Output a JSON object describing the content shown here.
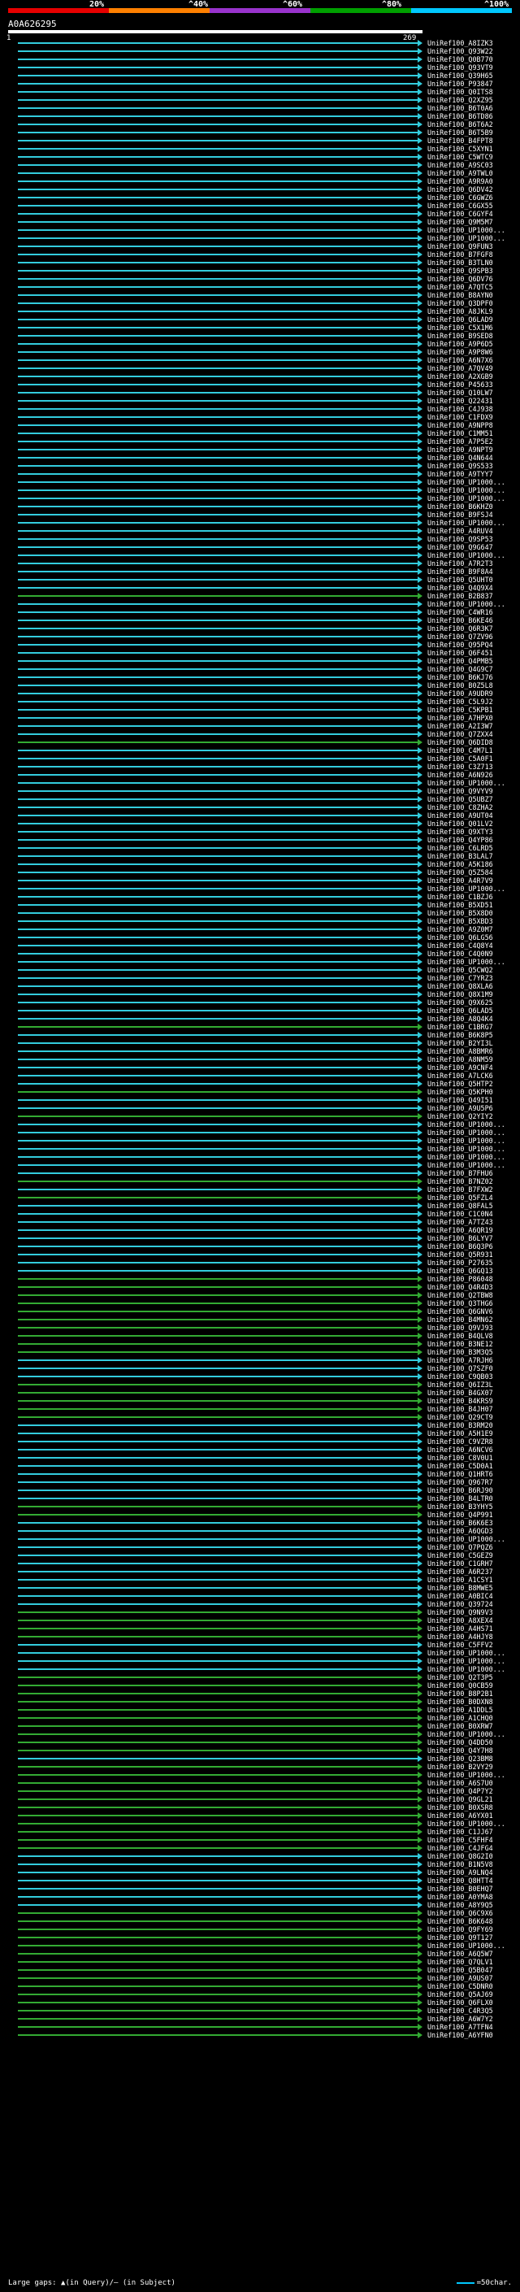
{
  "scale": {
    "labels": [
      "20%",
      "^40%",
      "^60%",
      "^80%",
      "^100%"
    ],
    "colors": [
      "#e60000",
      "#ff8000",
      "#9933cc",
      "#00a000",
      "#00c8ff"
    ]
  },
  "query": {
    "name": "A0A626295",
    "start": "1",
    "end": "269"
  },
  "legend": {
    "left": "Large gaps: ▲(in Query)/– (in Subject)",
    "right": "=50char."
  },
  "colors": {
    "hit_blue": "#33ccdd",
    "hit_green": "#33aa33",
    "background": "#000000"
  },
  "hits": [
    {
      "label": "UniRef100_A8IZK3",
      "color": "b"
    },
    {
      "label": "UniRef100_Q93W22",
      "color": "b"
    },
    {
      "label": "UniRef100_Q0B770",
      "color": "b"
    },
    {
      "label": "UniRef100_Q93VT9",
      "color": "b"
    },
    {
      "label": "UniRef100_Q39H65",
      "color": "b"
    },
    {
      "label": "UniRef100_P93847",
      "color": "b"
    },
    {
      "label": "UniRef100_Q0ITS8",
      "color": "b"
    },
    {
      "label": "UniRef100_Q2XZ95",
      "color": "b"
    },
    {
      "label": "UniRef100_B6T0A6",
      "color": "b"
    },
    {
      "label": "UniRef100_B6TD86",
      "color": "b"
    },
    {
      "label": "UniRef100_B6T6A2",
      "color": "b"
    },
    {
      "label": "UniRef100_B6T5B9",
      "color": "b"
    },
    {
      "label": "UniRef100_B4FPT8",
      "color": "b"
    },
    {
      "label": "UniRef100_C5XYN1",
      "color": "b"
    },
    {
      "label": "UniRef100_C5WTC9",
      "color": "b"
    },
    {
      "label": "UniRef100_A9SC03",
      "color": "b"
    },
    {
      "label": "UniRef100_A9TWL0",
      "color": "b"
    },
    {
      "label": "UniRef100_A9R9A0",
      "color": "b"
    },
    {
      "label": "UniRef100_Q6DV42",
      "color": "b"
    },
    {
      "label": "UniRef100_C6GWZ6",
      "color": "b"
    },
    {
      "label": "UniRef100_C6GX55",
      "color": "b"
    },
    {
      "label": "UniRef100_C6GYF4",
      "color": "b"
    },
    {
      "label": "UniRef100_Q9M5M7",
      "color": "b"
    },
    {
      "label": "UniRef100_UP1000...",
      "color": "b"
    },
    {
      "label": "UniRef100_UP1000...",
      "color": "b"
    },
    {
      "label": "UniRef100_Q9FUN3",
      "color": "b"
    },
    {
      "label": "UniRef100_B7FGF8",
      "color": "b"
    },
    {
      "label": "UniRef100_B3TLN0",
      "color": "b"
    },
    {
      "label": "UniRef100_Q9SPB3",
      "color": "b"
    },
    {
      "label": "UniRef100_Q6DV76",
      "color": "b"
    },
    {
      "label": "UniRef100_A7QTC5",
      "color": "b"
    },
    {
      "label": "UniRef100_B8AYN0",
      "color": "b"
    },
    {
      "label": "UniRef100_Q3DPF0",
      "color": "b"
    },
    {
      "label": "UniRef100_A8JKL9",
      "color": "b"
    },
    {
      "label": "UniRef100_Q6LAD9",
      "color": "b"
    },
    {
      "label": "UniRef100_C5X1M6",
      "color": "b"
    },
    {
      "label": "UniRef100_B9SED8",
      "color": "b"
    },
    {
      "label": "UniRef100_A9P6D5",
      "color": "b"
    },
    {
      "label": "UniRef100_A9P8W6",
      "color": "b"
    },
    {
      "label": "UniRef100_A6N7X6",
      "color": "b"
    },
    {
      "label": "UniRef100_A7QV49",
      "color": "b"
    },
    {
      "label": "UniRef100_A2XGB9",
      "color": "b"
    },
    {
      "label": "UniRef100_P45633",
      "color": "b"
    },
    {
      "label": "UniRef100_Q10LW7",
      "color": "b"
    },
    {
      "label": "UniRef100_Q22431",
      "color": "b"
    },
    {
      "label": "UniRef100_C4J938",
      "color": "b"
    },
    {
      "label": "UniRef100_C1FDX9",
      "color": "b"
    },
    {
      "label": "UniRef100_A9NPP8",
      "color": "b"
    },
    {
      "label": "UniRef100_C1MM51",
      "color": "b"
    },
    {
      "label": "UniRef100_A7P5E2",
      "color": "b"
    },
    {
      "label": "UniRef100_A9NPT9",
      "color": "b"
    },
    {
      "label": "UniRef100_Q4N644",
      "color": "b"
    },
    {
      "label": "UniRef100_Q9S533",
      "color": "b"
    },
    {
      "label": "UniRef100_A9TYY7",
      "color": "b"
    },
    {
      "label": "UniRef100_UP1000...",
      "color": "b"
    },
    {
      "label": "UniRef100_UP1000...",
      "color": "b"
    },
    {
      "label": "UniRef100_UP1000...",
      "color": "b"
    },
    {
      "label": "UniRef100_B6KHZ0",
      "color": "b"
    },
    {
      "label": "UniRef100_B9FSJ4",
      "color": "b"
    },
    {
      "label": "UniRef100_UP1000...",
      "color": "b"
    },
    {
      "label": "UniRef100_A4RUV4",
      "color": "b"
    },
    {
      "label": "UniRef100_Q9SP53",
      "color": "b"
    },
    {
      "label": "UniRef100_Q9G647",
      "color": "b"
    },
    {
      "label": "UniRef100_UP1000...",
      "color": "b"
    },
    {
      "label": "UniRef100_A7R2T3",
      "color": "b"
    },
    {
      "label": "UniRef100_B9F8A4",
      "color": "b"
    },
    {
      "label": "UniRef100_Q5UHT0",
      "color": "b"
    },
    {
      "label": "UniRef100_Q4Q9X4",
      "color": "b"
    },
    {
      "label": "UniRef100_B2B837",
      "color": "g"
    },
    {
      "label": "UniRef100_UP1000...",
      "color": "b"
    },
    {
      "label": "UniRef100_C4WR16",
      "color": "b"
    },
    {
      "label": "UniRef100_B6KE46",
      "color": "b"
    },
    {
      "label": "UniRef100_Q6R3K7",
      "color": "b"
    },
    {
      "label": "UniRef100_Q7ZV96",
      "color": "b"
    },
    {
      "label": "UniRef100_Q95PQ4",
      "color": "b"
    },
    {
      "label": "UniRef100_Q6F451",
      "color": "b"
    },
    {
      "label": "UniRef100_Q4PMB5",
      "color": "b"
    },
    {
      "label": "UniRef100_Q4G9C7",
      "color": "b"
    },
    {
      "label": "UniRef100_B6KJ76",
      "color": "b"
    },
    {
      "label": "UniRef100_B0Z5L8",
      "color": "b"
    },
    {
      "label": "UniRef100_A9UDR9",
      "color": "b"
    },
    {
      "label": "UniRef100_C5L9J2",
      "color": "b"
    },
    {
      "label": "UniRef100_C5KPB1",
      "color": "b"
    },
    {
      "label": "UniRef100_A7HPX0",
      "color": "b"
    },
    {
      "label": "UniRef100_A2I3W7",
      "color": "b"
    },
    {
      "label": "UniRef100_Q7ZXX4",
      "color": "b"
    },
    {
      "label": "UniRef100_Q6DID8",
      "color": "g"
    },
    {
      "label": "UniRef100_C4M7L1",
      "color": "b"
    },
    {
      "label": "UniRef100_C5A0F1",
      "color": "b"
    },
    {
      "label": "UniRef100_C3Z713",
      "color": "b"
    },
    {
      "label": "UniRef100_A6N926",
      "color": "b"
    },
    {
      "label": "UniRef100_UP1000...",
      "color": "b"
    },
    {
      "label": "UniRef100_Q9VYV9",
      "color": "b"
    },
    {
      "label": "UniRef100_Q5UBZ7",
      "color": "b"
    },
    {
      "label": "UniRef100_C8ZHA2",
      "color": "b"
    },
    {
      "label": "UniRef100_A9UT04",
      "color": "b"
    },
    {
      "label": "UniRef100_Q01LV2",
      "color": "b"
    },
    {
      "label": "UniRef100_Q9XTY3",
      "color": "b"
    },
    {
      "label": "UniRef100_Q4YP86",
      "color": "b"
    },
    {
      "label": "UniRef100_C6LRD5",
      "color": "b"
    },
    {
      "label": "UniRef100_B3LAL7",
      "color": "b"
    },
    {
      "label": "UniRef100_A5K186",
      "color": "b"
    },
    {
      "label": "UniRef100_Q5Z584",
      "color": "b"
    },
    {
      "label": "UniRef100_A4R7V9",
      "color": "b"
    },
    {
      "label": "UniRef100_UP1000...",
      "color": "b"
    },
    {
      "label": "UniRef100_C1BZJ6",
      "color": "b"
    },
    {
      "label": "UniRef100_B5XD51",
      "color": "b"
    },
    {
      "label": "UniRef100_B5X8D0",
      "color": "b"
    },
    {
      "label": "UniRef100_B5XBD3",
      "color": "b"
    },
    {
      "label": "UniRef100_A9Z0M7",
      "color": "b"
    },
    {
      "label": "UniRef100_Q6LG56",
      "color": "b"
    },
    {
      "label": "UniRef100_C4Q8Y4",
      "color": "b"
    },
    {
      "label": "UniRef100_C4Q0N9",
      "color": "b"
    },
    {
      "label": "UniRef100_UP1000...",
      "color": "b"
    },
    {
      "label": "UniRef100_Q5CWQ2",
      "color": "b"
    },
    {
      "label": "UniRef100_C7YRZ3",
      "color": "b"
    },
    {
      "label": "UniRef100_Q8XLA6",
      "color": "b"
    },
    {
      "label": "UniRef100_Q8X1M9",
      "color": "b"
    },
    {
      "label": "UniRef100_Q9X625",
      "color": "b"
    },
    {
      "label": "UniRef100_Q6LAD5",
      "color": "b"
    },
    {
      "label": "UniRef100_A8Q4K4",
      "color": "b"
    },
    {
      "label": "UniRef100_C1BRG7",
      "color": "g"
    },
    {
      "label": "UniRef100_B6K8P5",
      "color": "b"
    },
    {
      "label": "UniRef100_B2YI3L",
      "color": "b"
    },
    {
      "label": "UniRef100_A8BMR6",
      "color": "b"
    },
    {
      "label": "UniRef100_A8NM59",
      "color": "b"
    },
    {
      "label": "UniRef100_A9CNF4",
      "color": "b"
    },
    {
      "label": "UniRef100_A7LCK6",
      "color": "b"
    },
    {
      "label": "UniRef100_Q5HTP2",
      "color": "b"
    },
    {
      "label": "UniRef100_Q5KPH0",
      "color": "g"
    },
    {
      "label": "UniRef100_Q49I51",
      "color": "b"
    },
    {
      "label": "UniRef100_A9U5P6",
      "color": "b"
    },
    {
      "label": "UniRef100_Q2YIY2",
      "color": "g"
    },
    {
      "label": "UniRef100_UP1000...",
      "color": "b"
    },
    {
      "label": "UniRef100_UP1000...",
      "color": "b"
    },
    {
      "label": "UniRef100_UP1000...",
      "color": "b"
    },
    {
      "label": "UniRef100_UP1000...",
      "color": "b"
    },
    {
      "label": "UniRef100_UP1000...",
      "color": "b"
    },
    {
      "label": "UniRef100_UP1000...",
      "color": "b"
    },
    {
      "label": "UniRef100_B7FHU6",
      "color": "b"
    },
    {
      "label": "UniRef100_B7NZ02",
      "color": "g"
    },
    {
      "label": "UniRef100_B7FXW2",
      "color": "b"
    },
    {
      "label": "UniRef100_Q5FZL4",
      "color": "g"
    },
    {
      "label": "UniRef100_Q8FAL5",
      "color": "b"
    },
    {
      "label": "UniRef100_C1C0N4",
      "color": "b"
    },
    {
      "label": "UniRef100_A7TZ43",
      "color": "b"
    },
    {
      "label": "UniRef100_A6QR19",
      "color": "b"
    },
    {
      "label": "UniRef100_B6LYV7",
      "color": "b"
    },
    {
      "label": "UniRef100_B6Q3P6",
      "color": "b"
    },
    {
      "label": "UniRef100_Q5R931",
      "color": "b"
    },
    {
      "label": "UniRef100_P27635",
      "color": "b"
    },
    {
      "label": "UniRef100_Q6GQ13",
      "color": "b"
    },
    {
      "label": "UniRef100_P86048",
      "color": "g"
    },
    {
      "label": "UniRef100_Q4R4D3",
      "color": "g"
    },
    {
      "label": "UniRef100_Q2TBW8",
      "color": "g"
    },
    {
      "label": "UniRef100_Q3THG6",
      "color": "g"
    },
    {
      "label": "UniRef100_Q6GNV6",
      "color": "g"
    },
    {
      "label": "UniRef100_B4MN62",
      "color": "g"
    },
    {
      "label": "UniRef100_Q9VJ93",
      "color": "g"
    },
    {
      "label": "UniRef100_B4QLV8",
      "color": "g"
    },
    {
      "label": "UniRef100_B3NE12",
      "color": "g"
    },
    {
      "label": "UniRef100_B3M3Q5",
      "color": "g"
    },
    {
      "label": "UniRef100_A7RJH6",
      "color": "b"
    },
    {
      "label": "UniRef100_Q7SZF0",
      "color": "b"
    },
    {
      "label": "UniRef100_C9QB03",
      "color": "b"
    },
    {
      "label": "UniRef100_Q6IZ3L",
      "color": "g"
    },
    {
      "label": "UniRef100_B4GX07",
      "color": "g"
    },
    {
      "label": "UniRef100_B4KRS9",
      "color": "g"
    },
    {
      "label": "UniRef100_B4JH07",
      "color": "g"
    },
    {
      "label": "UniRef100_Q29CT9",
      "color": "g"
    },
    {
      "label": "UniRef100_B3RM20",
      "color": "b"
    },
    {
      "label": "UniRef100_A5H1E9",
      "color": "b"
    },
    {
      "label": "UniRef100_C9VZR8",
      "color": "b"
    },
    {
      "label": "UniRef100_A6NCV6",
      "color": "b"
    },
    {
      "label": "UniRef100_C8V0U1",
      "color": "b"
    },
    {
      "label": "UniRef100_C5D0A1",
      "color": "b"
    },
    {
      "label": "UniRef100_Q1HRT6",
      "color": "b"
    },
    {
      "label": "UniRef100_Q967R7",
      "color": "b"
    },
    {
      "label": "UniRef100_B6RJ90",
      "color": "b"
    },
    {
      "label": "UniRef100_B4LTR0",
      "color": "b"
    },
    {
      "label": "UniRef100_B3YHY5",
      "color": "g"
    },
    {
      "label": "UniRef100_Q4P991",
      "color": "g"
    },
    {
      "label": "UniRef100_B6K6E3",
      "color": "b"
    },
    {
      "label": "UniRef100_A6QGD3",
      "color": "b"
    },
    {
      "label": "UniRef100_UP1000...",
      "color": "b"
    },
    {
      "label": "UniRef100_Q7PQZ6",
      "color": "b"
    },
    {
      "label": "UniRef100_C5GEZ9",
      "color": "b"
    },
    {
      "label": "UniRef100_C1GRH7",
      "color": "b"
    },
    {
      "label": "UniRef100_A6R237",
      "color": "b"
    },
    {
      "label": "UniRef100_A1CSY1",
      "color": "b"
    },
    {
      "label": "UniRef100_B8MWE5",
      "color": "b"
    },
    {
      "label": "UniRef100_A0BIC4",
      "color": "b"
    },
    {
      "label": "UniRef100_Q39724",
      "color": "b"
    },
    {
      "label": "UniRef100_Q9N9V3",
      "color": "g"
    },
    {
      "label": "UniRef100_A8XEX4",
      "color": "g"
    },
    {
      "label": "UniRef100_A4HS71",
      "color": "g"
    },
    {
      "label": "UniRef100_A4HJY8",
      "color": "g"
    },
    {
      "label": "UniRef100_C5FFV2",
      "color": "b"
    },
    {
      "label": "UniRef100_UP1000...",
      "color": "b"
    },
    {
      "label": "UniRef100_UP1000...",
      "color": "b"
    },
    {
      "label": "UniRef100_UP1000...",
      "color": "b"
    },
    {
      "label": "UniRef100_Q2T3P5",
      "color": "g"
    },
    {
      "label": "UniRef100_Q0CB59",
      "color": "g"
    },
    {
      "label": "UniRef100_B8P2B1",
      "color": "g"
    },
    {
      "label": "UniRef100_B0DXN8",
      "color": "g"
    },
    {
      "label": "UniRef100_A1DDL5",
      "color": "g"
    },
    {
      "label": "UniRef100_A1CHQ0",
      "color": "g"
    },
    {
      "label": "UniRef100_B0XRW7",
      "color": "g"
    },
    {
      "label": "UniRef100_UP1000...",
      "color": "g"
    },
    {
      "label": "UniRef100_Q4DD50",
      "color": "g"
    },
    {
      "label": "UniRef100_Q4Y7H8",
      "color": "g"
    },
    {
      "label": "UniRef100_Q23BM8",
      "color": "b"
    },
    {
      "label": "UniRef100_B2VY29",
      "color": "g"
    },
    {
      "label": "UniRef100_UP1000...",
      "color": "g"
    },
    {
      "label": "UniRef100_A6S7U0",
      "color": "g"
    },
    {
      "label": "UniRef100_Q4P7Y2",
      "color": "g"
    },
    {
      "label": "UniRef100_Q9GL21",
      "color": "g"
    },
    {
      "label": "UniRef100_B0XSR8",
      "color": "g"
    },
    {
      "label": "UniRef100_A6YX01",
      "color": "g"
    },
    {
      "label": "UniRef100_UP1000...",
      "color": "g"
    },
    {
      "label": "UniRef100_C1JJ67",
      "color": "g"
    },
    {
      "label": "UniRef100_C5FHF4",
      "color": "g"
    },
    {
      "label": "UniRef100_C4JFG4",
      "color": "g"
    },
    {
      "label": "UniRef100_Q8G2I0",
      "color": "b"
    },
    {
      "label": "UniRef100_B1N5V8",
      "color": "b"
    },
    {
      "label": "UniRef100_A9LNQ4",
      "color": "b"
    },
    {
      "label": "UniRef100_Q8HTT4",
      "color": "b"
    },
    {
      "label": "UniRef100_B0EHQ7",
      "color": "b"
    },
    {
      "label": "UniRef100_A0YMA8",
      "color": "b"
    },
    {
      "label": "UniRef100_A8Y9Q5",
      "color": "b"
    },
    {
      "label": "UniRef100_Q6C9X6",
      "color": "g"
    },
    {
      "label": "UniRef100_B6K648",
      "color": "g"
    },
    {
      "label": "UniRef100_Q9FY69",
      "color": "g"
    },
    {
      "label": "UniRef100_Q9T127",
      "color": "g"
    },
    {
      "label": "UniRef100_UP1000...",
      "color": "g"
    },
    {
      "label": "UniRef100_A6Q5W7",
      "color": "g"
    },
    {
      "label": "UniRef100_Q7QLV1",
      "color": "g"
    },
    {
      "label": "UniRef100_Q5B047",
      "color": "g"
    },
    {
      "label": "UniRef100_A9US07",
      "color": "g"
    },
    {
      "label": "UniRef100_C5DNR0",
      "color": "g"
    },
    {
      "label": "UniRef100_Q5AJ69",
      "color": "g"
    },
    {
      "label": "UniRef100_Q6FLX0",
      "color": "g"
    },
    {
      "label": "UniRef100_C4R3Q5",
      "color": "g"
    },
    {
      "label": "UniRef100_A6W7Y2",
      "color": "g"
    },
    {
      "label": "UniRef100_A7TFN4",
      "color": "g"
    },
    {
      "label": "UniRef100_A6YFN0",
      "color": "g"
    }
  ]
}
